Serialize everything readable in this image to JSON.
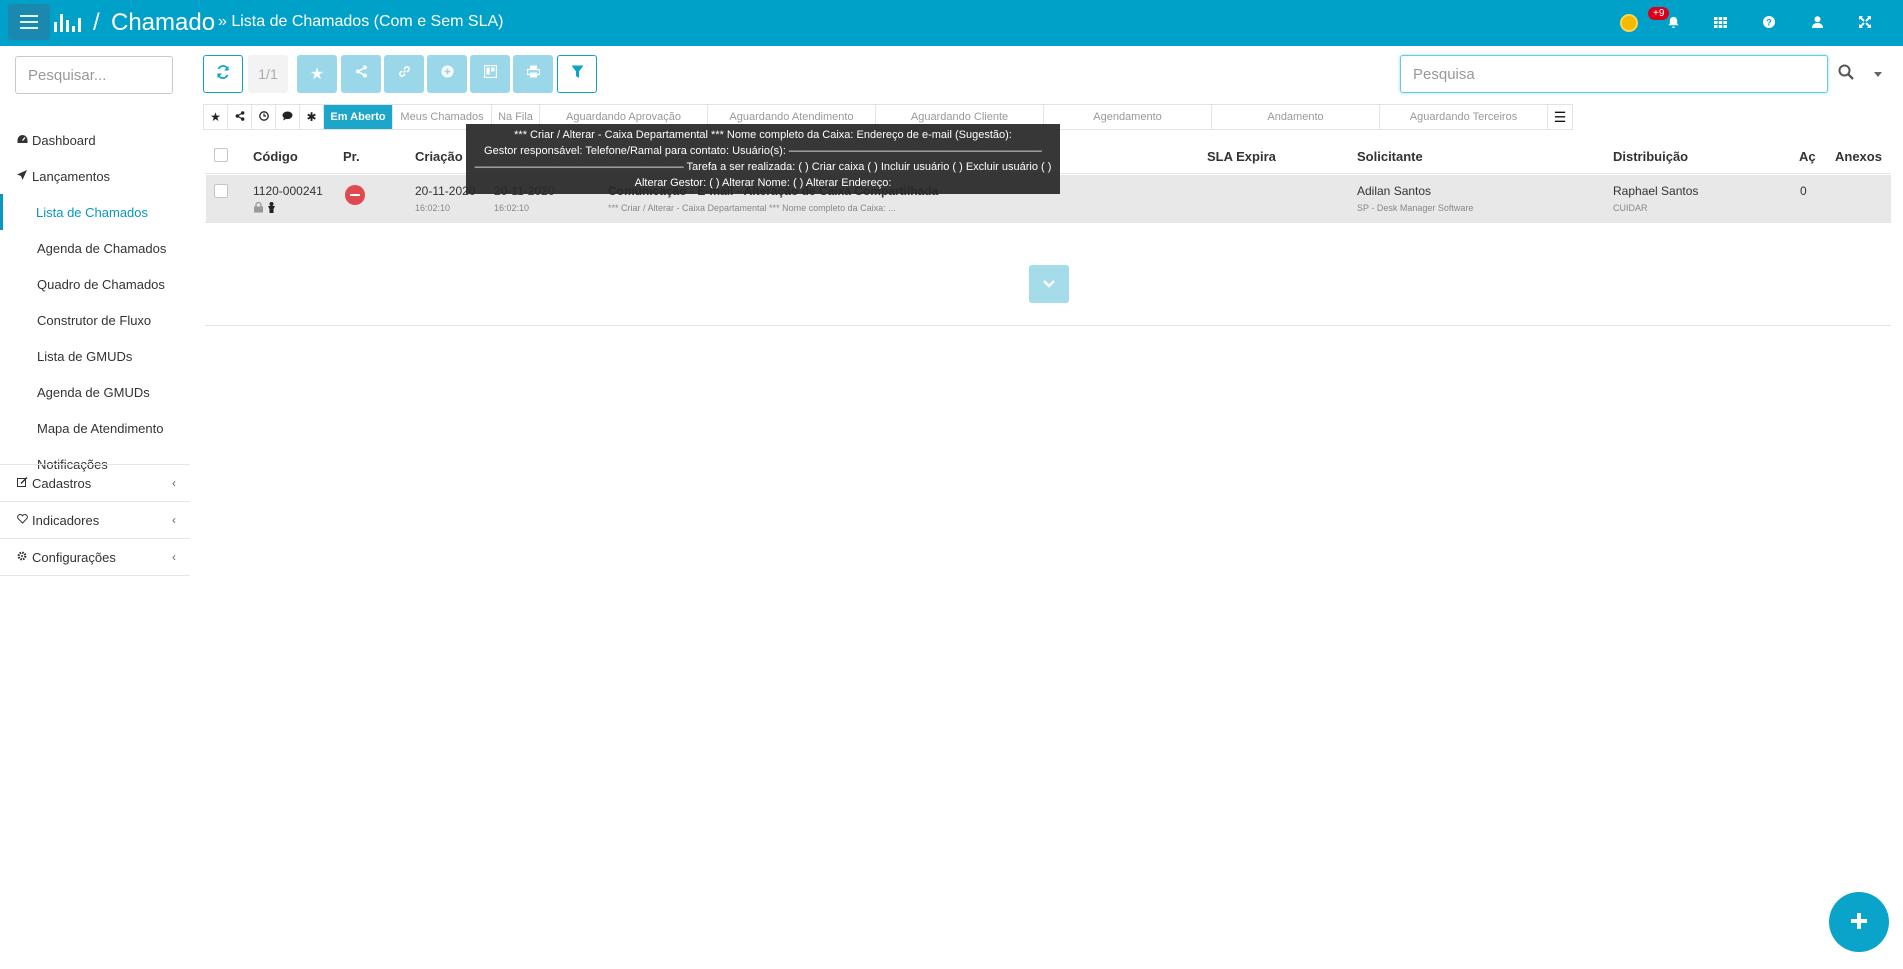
{
  "header": {
    "module": "Chamado",
    "separator": "/",
    "page_title": "» Lista de Chamados (Com e Sem SLA)",
    "notification_badge": "+9"
  },
  "sidebar": {
    "search_placeholder": "Pesquisar...",
    "items": [
      {
        "label": "Dashboard",
        "icon": "dashboard-icon"
      },
      {
        "label": "Lançamentos",
        "icon": "paper-plane-icon"
      },
      {
        "label": "Lista de Chamados",
        "active": true
      },
      {
        "label": "Agenda de Chamados"
      },
      {
        "label": "Quadro de Chamados"
      },
      {
        "label": "Construtor de Fluxo"
      },
      {
        "label": "Lista de GMUDs"
      },
      {
        "label": "Agenda de GMUDs"
      },
      {
        "label": "Mapa de Atendimento"
      },
      {
        "label": "Notificações"
      },
      {
        "label": "Cadastros",
        "icon": "edit-icon"
      },
      {
        "label": "Indicadores",
        "icon": "heart-icon"
      },
      {
        "label": "Configurações",
        "icon": "gear-icon"
      }
    ]
  },
  "toolbar": {
    "page_indicator": "1/1",
    "search_placeholder": "Pesquisa"
  },
  "tabs": {
    "em_aberto": "Em Aberto",
    "meus_chamados": "Meus Chamados",
    "na_fila": "Na Fila",
    "aguardando_aprovacao": "Aguardando Aprovação",
    "aguardando_atendimento": "Aguardando Atendimento",
    "aguardando_cliente": "Aguardando Cliente",
    "agendamento": "Agendamento",
    "andamento": "Andamento",
    "aguardando_terceiros": "Aguardando Terceiros"
  },
  "table": {
    "headers": {
      "codigo": "Código",
      "prioridade": "Pr.",
      "criacao": "Criação",
      "sla_expira": "SLA Expira",
      "solicitante": "Solicitante",
      "distribuicao": "Distribuição",
      "acoes": "Aç",
      "anexos": "Anexos"
    },
    "rows": [
      {
        "codigo": "1120-000241",
        "criacao_data": "20-11-2020",
        "criacao_hora": "16:02:10",
        "col2_data": "20-11-2020",
        "col2_hora": "16:02:10",
        "assunto": "Comunicação - E-mail - Alteração de Caixa Compartilhada",
        "descricao": "*** Criar / Alterar - Caixa Departamental *** Nome completo da Caixa:   ...",
        "solicitante": "Adilan Santos",
        "solicitante_empresa": "SP - Desk Manager Software",
        "distribuicao": "Raphael Santos",
        "distribuicao_grupo": "CUIDAR",
        "acoes": "0"
      }
    ]
  },
  "tooltip": {
    "line1": "*** Criar / Alterar - Caixa Departamental *** Nome completo da Caixa:   Endereço de e-mail (Sugestão):",
    "line2": "Gestor responsável:    Telefone/Ramal para contato: Usuário(s): ———————————————————————",
    "line3": "——————————————————— Tarefa a ser realizada: ( ) Criar caixa ( ) Incluir usuário ( ) Excluir usuário ( )",
    "line4": "Alterar Gestor: ( ) Alterar Nome: ( ) Alterar Endereço:"
  },
  "colors": {
    "header_bg": "#00a1c9",
    "accent": "#0a96c4",
    "priority_red": "#e0494f"
  }
}
